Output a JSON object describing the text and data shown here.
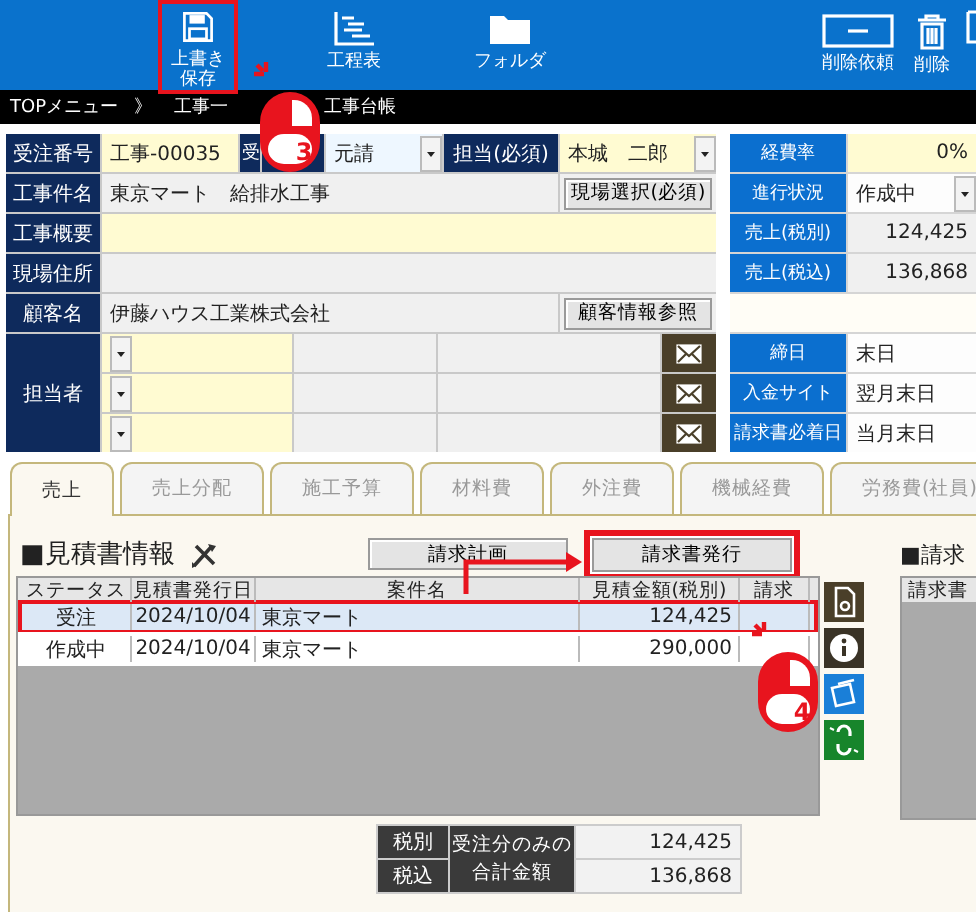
{
  "toolbar": {
    "left": [
      {
        "kind": "button",
        "lines": [
          "上書き",
          "保存"
        ],
        "marked": true
      },
      {
        "kind": "button",
        "lines": [
          "工程表"
        ],
        "marked": false
      },
      {
        "kind": "button",
        "lines": [
          "フォルダ"
        ],
        "marked": false
      }
    ],
    "right": [
      {
        "kind": "button",
        "lines": [
          "削除依頼"
        ],
        "marked": false
      },
      {
        "kind": "button",
        "lines": [
          "削除"
        ],
        "marked": false
      },
      {
        "kind": "clipped"
      }
    ]
  },
  "breadcrumb": [
    "TOPメニュー",
    "》",
    "工事一",
    "工事台帳"
  ],
  "project": {
    "order_no": {
      "label": "受注番号",
      "value": "工事-00035"
    },
    "contract": {
      "label": "受",
      "value": "元請"
    },
    "manager": {
      "label": "担当(必須)",
      "value": "本城　二郎"
    },
    "title": {
      "label": "工事件名",
      "value": "東京マート　給排水工事",
      "button": "現場選択(必須)"
    },
    "summary": {
      "label": "工事概要"
    },
    "site": {
      "label": "現場住所"
    },
    "customer": {
      "label": "顧客名",
      "value": "伊藤ハウス工業株式会社",
      "button": "顧客情報参照"
    },
    "contacts": {
      "label": "担当者",
      "entries": [
        {
          "kind": "blank"
        },
        {
          "kind": "blank"
        },
        {
          "kind": "blank"
        }
      ]
    }
  },
  "figures": [
    {
      "kind": "rate",
      "label": "経費率",
      "value": "0%"
    },
    {
      "kind": "select",
      "label": "進行状況",
      "value": "作成中"
    },
    {
      "kind": "amount",
      "label": "売上(税別)",
      "value": "124,425"
    },
    {
      "kind": "amount",
      "label": "売上(税込)",
      "value": "136,868"
    },
    {
      "kind": "gap"
    },
    {
      "kind": "text",
      "label": "締日",
      "value": "末日"
    },
    {
      "kind": "text",
      "label": "入金サイト",
      "value": "翌月末日"
    },
    {
      "kind": "text",
      "label": "請求書必着日",
      "value": "当月末日"
    }
  ],
  "tabs": [
    {
      "label": "売上",
      "selected": true
    },
    {
      "label": "売上分配",
      "selected": false
    },
    {
      "label": "施工予算",
      "selected": false
    },
    {
      "label": "材料費",
      "selected": false
    },
    {
      "label": "外注費",
      "selected": false
    },
    {
      "label": "機械経費",
      "selected": false
    },
    {
      "label": "労務費(社員)",
      "selected": false
    }
  ],
  "estimates": {
    "title": "■見積書情報",
    "buttons": [
      {
        "label": "請求計画",
        "marked": false
      },
      {
        "label": "請求書発行",
        "marked": true
      }
    ],
    "columns": [
      "ステータス",
      "見積書発行日",
      "案件名",
      "見積金額(税別)",
      "請求"
    ],
    "rows": [
      {
        "status": "受注",
        "date": "2024/10/04",
        "name": "東京マート",
        "amount": "124,425",
        "selected": true,
        "marked": true
      },
      {
        "status": "作成中",
        "date": "2024/10/04",
        "name": "東京マート",
        "amount": "290,000",
        "selected": false,
        "marked": false
      }
    ]
  },
  "totals": {
    "rows": [
      {
        "label": "税別",
        "value": "124,425"
      },
      {
        "label": "税込",
        "value": "136,868"
      }
    ],
    "caption": "受注分のみの合計金額"
  },
  "invoices": {
    "title": "■請求",
    "columns": [
      "請求書"
    ]
  },
  "click_markers": [
    {
      "number": "3"
    },
    {
      "number": "4"
    }
  ]
}
